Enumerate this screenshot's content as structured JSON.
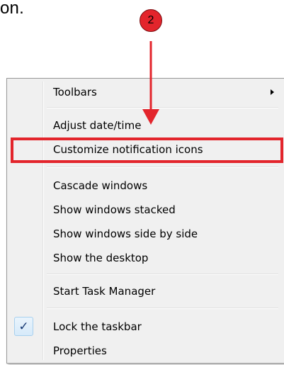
{
  "caption": {
    "fragment": "on."
  },
  "step": {
    "number": "2",
    "color": "#e3252c"
  },
  "menu": {
    "items": [
      {
        "label": "Toolbars",
        "has_submenu": true
      },
      {
        "label": "Adjust date/time"
      },
      {
        "label": "Customize notification icons",
        "highlighted": true
      },
      {
        "label": "Cascade windows"
      },
      {
        "label": "Show windows stacked"
      },
      {
        "label": "Show windows side by side"
      },
      {
        "label": "Show the desktop"
      },
      {
        "label": "Start Task Manager"
      },
      {
        "label": "Lock the taskbar",
        "checked": true,
        "check_glyph": "✓"
      },
      {
        "label": "Properties"
      }
    ]
  },
  "colors": {
    "annotation_red": "#e3252c",
    "menu_background": "#f0f0f0",
    "menu_border": "#979797"
  }
}
